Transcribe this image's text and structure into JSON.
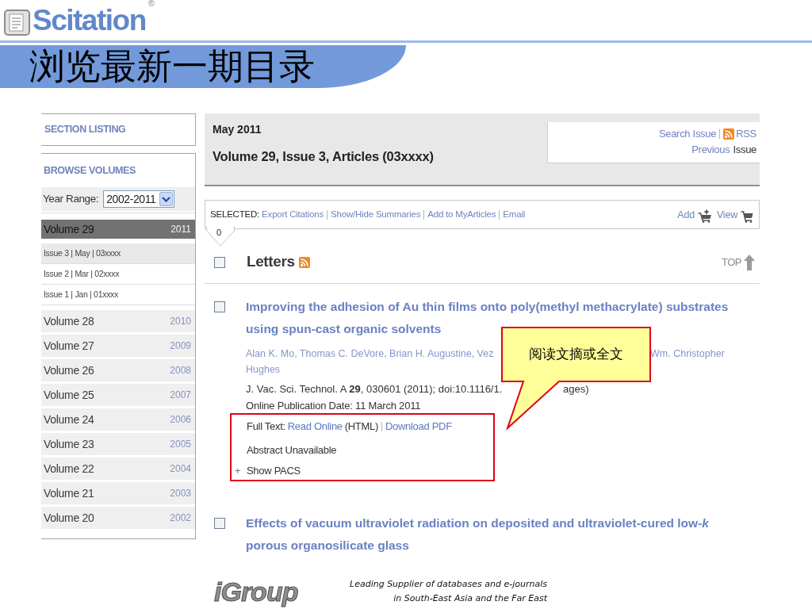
{
  "header": {
    "logo": "Scitation",
    "logo_mark": "®",
    "title": "浏览最新一期目录"
  },
  "sidebar": {
    "section_listing": "SECTION LISTING",
    "browse_heading": "BROWSE VOLUMES",
    "year_range": {
      "label": "Year Range:",
      "value": "2002-2011"
    },
    "volumes": [
      {
        "label": "Volume 29",
        "year": "2011",
        "selected": true,
        "children": [
          {
            "label": "Issue 3 | May | 03xxxx",
            "selected": true
          },
          {
            "label": "Issue 2 | Mar | 02xxxx",
            "selected": false
          },
          {
            "label": "Issue 1 | Jan | 01xxxx",
            "selected": false
          }
        ]
      },
      {
        "label": "Volume 28",
        "year": "2010",
        "selected": false
      },
      {
        "label": "Volume 27",
        "year": "2009",
        "selected": false
      },
      {
        "label": "Volume 26",
        "year": "2008",
        "selected": false
      },
      {
        "label": "Volume 25",
        "year": "2007",
        "selected": false
      },
      {
        "label": "Volume 24",
        "year": "2006",
        "selected": false
      },
      {
        "label": "Volume 23",
        "year": "2005",
        "selected": false
      },
      {
        "label": "Volume 22",
        "year": "2004",
        "selected": false
      },
      {
        "label": "Volume 21",
        "year": "2003",
        "selected": false
      },
      {
        "label": "Volume 20",
        "year": "2002",
        "selected": false
      }
    ]
  },
  "issue_header": {
    "date": "May 2011",
    "title": "Volume 29, Issue 3, Articles (03xxxx)",
    "search_link": "Search Issue",
    "rss_link": "RSS",
    "previous_link": "Previous",
    "previous_suffix": "Issue"
  },
  "toolbar": {
    "label": "SELECTED:",
    "count": "0",
    "actions": [
      "Export Citations",
      "Show/Hide Summaries",
      "Add to MyArticles",
      "Email"
    ],
    "cart": [
      {
        "label": "Add",
        "kind": "add"
      },
      {
        "label": "View",
        "kind": "view"
      }
    ]
  },
  "section": {
    "title": "Letters",
    "checked": false,
    "top_link": "TOP"
  },
  "articles": [
    {
      "checked": false,
      "highlighted": true,
      "title": "Improving the adhesion of Au thin films onto poly(methyl methacrylate) substrates using spun-cast organic solvents",
      "authors": [
        "Alan K. Mo, Thomas C. DeVore, Brian H. Augustine, Vez",
        "Wm. Christopher",
        "Hughes"
      ],
      "citation": [
        "J. Vac. Sci. Technol. A **29**, 030601 (2011); doi:10.1116/1.",
        "ages)"
      ],
      "online_date": "Online Publication Date: 11 March 2011",
      "full_text": {
        "label": "Full Text:",
        "html_link": "Read Online",
        "html_note": "(HTML)",
        "pdf_link": "Download PDF"
      },
      "abstract": "Abstract Unavailable",
      "pacs": {
        "toggle": "+",
        "label": "Show PACS"
      }
    },
    {
      "checked": false,
      "title": "Effects of vacuum ultraviolet radiation on deposited and ultraviolet-cured low-*k* porous organosilicate glass"
    }
  ],
  "callout": "阅读文摘或全文",
  "footer": {
    "logo": "iGroup",
    "tagline": [
      "Leading Supplier of databases and e-journals",
      "in South-East Asia and the Far East"
    ]
  }
}
